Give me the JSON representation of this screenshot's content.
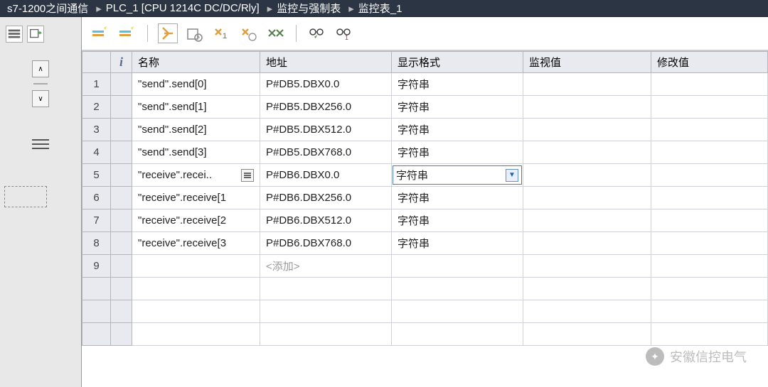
{
  "breadcrumb": {
    "items": [
      "s7-1200之间通信",
      "PLC_1 [CPU 1214C DC/DC/Rly]",
      "监控与强制表",
      "监控表_1"
    ],
    "separator": "▸"
  },
  "columns": {
    "info": "i",
    "name": "名称",
    "address": "地址",
    "format": "显示格式",
    "monitor": "监视值",
    "modify": "修改值"
  },
  "rows": [
    {
      "num": "1",
      "name": "\"send\".send[0]",
      "address": "P#DB5.DBX0.0",
      "format": "字符串",
      "monitor": "",
      "modify": "",
      "selected": false
    },
    {
      "num": "2",
      "name": "\"send\".send[1]",
      "address": "P#DB5.DBX256.0",
      "format": "字符串",
      "monitor": "",
      "modify": "",
      "selected": false
    },
    {
      "num": "3",
      "name": "\"send\".send[2]",
      "address": "P#DB5.DBX512.0",
      "format": "字符串",
      "monitor": "",
      "modify": "",
      "selected": false
    },
    {
      "num": "4",
      "name": "\"send\".send[3]",
      "address": "P#DB5.DBX768.0",
      "format": "字符串",
      "monitor": "",
      "modify": "",
      "selected": false
    },
    {
      "num": "5",
      "name": "\"receive\".recei..",
      "address": "P#DB6.DBX0.0",
      "format": "字符串",
      "monitor": "",
      "modify": "",
      "selected": true,
      "hasBrowse": true
    },
    {
      "num": "6",
      "name": "\"receive\".receive[1",
      "address": "P#DB6.DBX256.0",
      "format": "字符串",
      "monitor": "",
      "modify": "",
      "selected": false
    },
    {
      "num": "7",
      "name": "\"receive\".receive[2",
      "address": "P#DB6.DBX512.0",
      "format": "字符串",
      "monitor": "",
      "modify": "",
      "selected": false
    },
    {
      "num": "8",
      "name": "\"receive\".receive[3",
      "address": "P#DB6.DBX768.0",
      "format": "字符串",
      "monitor": "",
      "modify": "",
      "selected": false
    }
  ],
  "addRow": {
    "num": "9",
    "placeholder": "<添加>"
  },
  "watermark": {
    "text": "安徽信控电气"
  }
}
